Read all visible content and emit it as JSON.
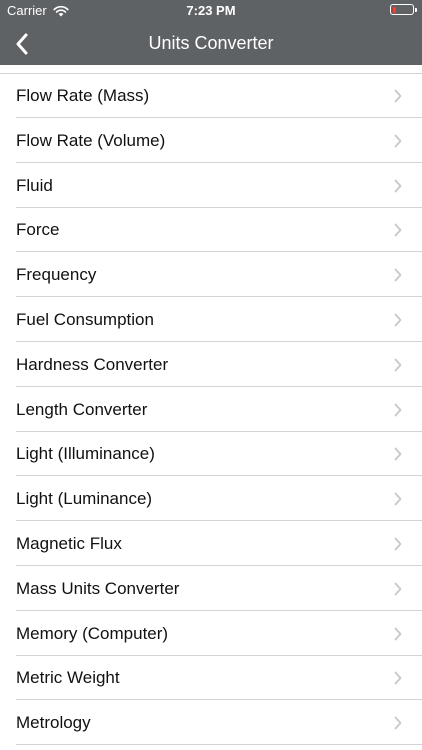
{
  "status_bar": {
    "carrier": "Carrier",
    "time": "7:23 PM",
    "battery_level": 0.15,
    "battery_color": "#ff3b30"
  },
  "nav": {
    "title": "Units Converter",
    "back_icon": "chevron-left-icon",
    "background": "#5f6265"
  },
  "items": [
    {
      "label": "Flow Rate (Mass)"
    },
    {
      "label": "Flow Rate (Volume)"
    },
    {
      "label": "Fluid"
    },
    {
      "label": "Force"
    },
    {
      "label": "Frequency"
    },
    {
      "label": "Fuel Consumption"
    },
    {
      "label": "Hardness Converter"
    },
    {
      "label": "Length Converter"
    },
    {
      "label": "Light (Illuminance)"
    },
    {
      "label": "Light (Luminance)"
    },
    {
      "label": "Magnetic Flux"
    },
    {
      "label": "Mass Units Converter"
    },
    {
      "label": "Memory (Computer)"
    },
    {
      "label": "Metric Weight"
    },
    {
      "label": "Metrology"
    }
  ]
}
